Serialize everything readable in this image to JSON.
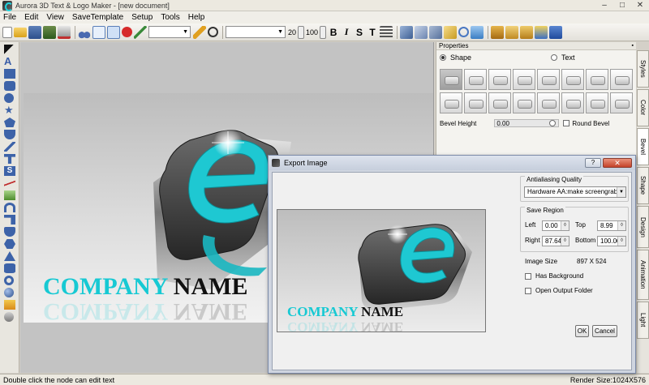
{
  "window": {
    "title": "Aurora 3D Text & Logo Maker - [new document]",
    "minimize": "–",
    "maximize": "□",
    "close": "✕"
  },
  "menu": [
    "File",
    "Edit",
    "View",
    "SaveTemplate",
    "Setup",
    "Tools",
    "Help"
  ],
  "toolbar": {
    "font_size": "20",
    "zoom": "100",
    "bold": "B",
    "italic": "I",
    "strike": "S",
    "special": "T"
  },
  "canvas": {
    "logo_word1": "COMPANY",
    "logo_word2": "NAME"
  },
  "properties": {
    "title": "Properties",
    "radio_shape": "Shape",
    "radio_text": "Text",
    "bevel_height_label": "Bevel Height",
    "bevel_height_value": "0.00",
    "round_bevel_label": "Round Bevel"
  },
  "side_tabs": [
    "Styles",
    "Color",
    "Bevel",
    "Shape",
    "Design",
    "Animation",
    "Light"
  ],
  "status": {
    "hint": "Double click the node can edit text",
    "render_size": "Render Size:1024X576"
  },
  "export_dialog": {
    "title": "Export Image",
    "help_label": "?",
    "close_label": "✕",
    "antialiasing_group": "Antialiasing Quality",
    "antialiasing_value": "Hardware AA:make screengrabs",
    "save_region_group": "Save Region",
    "left_label": "Left",
    "left_value": "0.00",
    "top_label": "Top",
    "top_value": "8.99",
    "right_label": "Right",
    "right_value": "87.64",
    "bottom_label": "Bottom",
    "bottom_value": "100.00",
    "image_size_label": "Image Size",
    "image_size_value": "897 X 524",
    "has_background_label": "Has Background",
    "open_output_label": "Open Output Folder",
    "ok_label": "OK",
    "cancel_label": "Cancel",
    "preview_word1": "COMPANY",
    "preview_word2": "NAME"
  }
}
